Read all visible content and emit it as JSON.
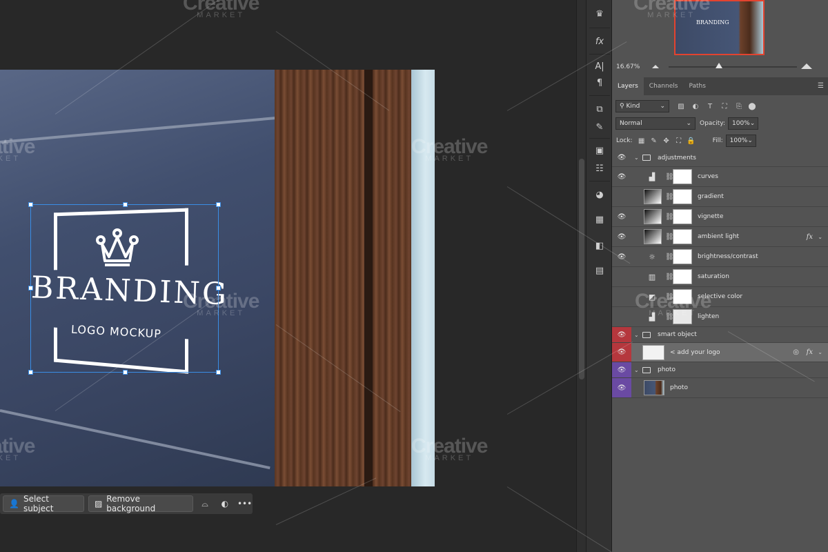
{
  "canvas": {
    "logo": {
      "brand": "BRANDING",
      "subtitle": "LOGO MOCKUP"
    }
  },
  "taskbar": {
    "select_subject": "Select subject",
    "remove_background": "Remove background"
  },
  "navigator": {
    "thumb_brand": "BRANDING",
    "zoom": "16.67%"
  },
  "layers_panel": {
    "tabs": [
      "Layers",
      "Channels",
      "Paths"
    ],
    "filter_kind": "Kind",
    "blend_mode": "Normal",
    "opacity_label": "Opacity:",
    "opacity_value": "100%",
    "lock_label": "Lock:",
    "fill_label": "Fill:",
    "fill_value": "100%",
    "layers": [
      {
        "name": "adjustments",
        "kind": "group",
        "visible": true
      },
      {
        "name": "curves",
        "kind": "adjustment",
        "visible": true,
        "icon": "curves-icon"
      },
      {
        "name": "gradient",
        "kind": "adjustment",
        "visible": false,
        "icon": "gradient-thumb"
      },
      {
        "name": "vignette",
        "kind": "adjustment",
        "visible": true,
        "icon": "gradient-thumb"
      },
      {
        "name": "ambient light",
        "kind": "adjustment",
        "visible": true,
        "icon": "gradient-thumb",
        "fx": true
      },
      {
        "name": "brightness/contrast",
        "kind": "adjustment",
        "visible": true,
        "icon": "sun-icon"
      },
      {
        "name": "saturation",
        "kind": "adjustment",
        "visible": false,
        "icon": "hue-saturation-icon"
      },
      {
        "name": "selective color",
        "kind": "adjustment",
        "visible": false,
        "icon": "selective-color-icon"
      },
      {
        "name": "lighten",
        "kind": "adjustment",
        "visible": false,
        "icon": "curves-icon"
      },
      {
        "name": "smart object",
        "kind": "group",
        "visible": true,
        "color": "#b5373d"
      },
      {
        "name": "< add your logo",
        "kind": "smart-object",
        "visible": true,
        "color": "#b5373d",
        "fx": true,
        "selected": true
      },
      {
        "name": "photo",
        "kind": "group",
        "visible": true,
        "color": "#6a4aa3"
      },
      {
        "name": "photo",
        "kind": "image",
        "visible": true,
        "color": "#6a4aa3"
      }
    ]
  },
  "watermark": {
    "line1": "Creative",
    "line2": "MARKET"
  },
  "colors": {
    "accent": "#3a8ee6",
    "nav_frame": "#e3432f",
    "smart_object_label": "#b5373d",
    "photo_label": "#6a4aa3"
  }
}
